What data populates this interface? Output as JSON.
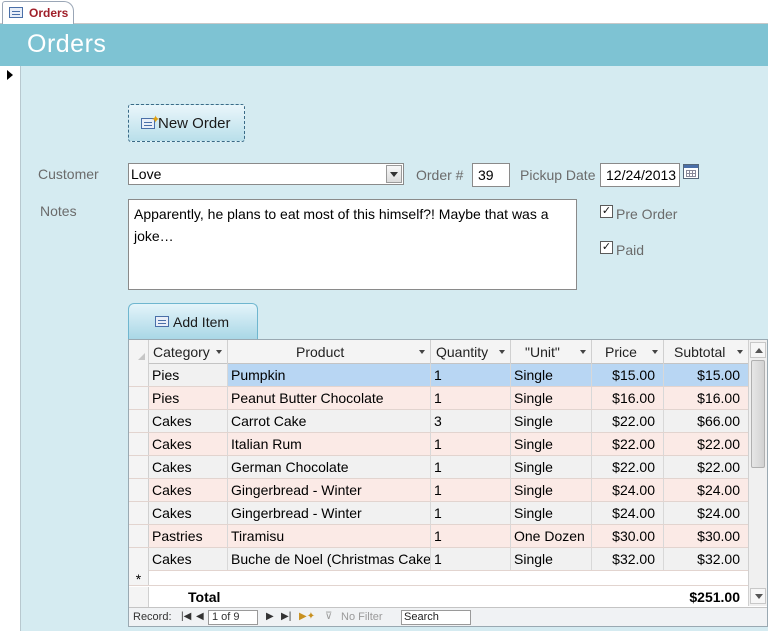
{
  "tab": {
    "label": "Orders",
    "icon": "form-icon"
  },
  "header": {
    "title": "Orders"
  },
  "form": {
    "new_order_label": "New Order",
    "customer_label": "Customer",
    "customer_value": "Love",
    "order_no_label": "Order #",
    "order_no_value": "39",
    "pickup_label": "Pickup Date",
    "pickup_value": "12/24/2013",
    "notes_label": "Notes",
    "notes_value": "Apparently, he plans to eat most of this himself?! Maybe that was a joke…",
    "pre_order_label": "Pre Order",
    "pre_order_checked": true,
    "paid_label": "Paid",
    "paid_checked": true,
    "add_item_label": "Add Item"
  },
  "grid": {
    "columns": [
      "Category",
      "Product",
      "Quantity",
      "\"Unit\"",
      "Price",
      "Subtotal"
    ],
    "rows": [
      {
        "category": "Pies",
        "product": "Pumpkin",
        "quantity": "1",
        "unit": "Single",
        "price": "$15.00",
        "subtotal": "$15.00",
        "selected": true
      },
      {
        "category": "Pies",
        "product": "Peanut Butter Chocolate",
        "quantity": "1",
        "unit": "Single",
        "price": "$16.00",
        "subtotal": "$16.00"
      },
      {
        "category": "Cakes",
        "product": "Carrot Cake",
        "quantity": "3",
        "unit": "Single",
        "price": "$22.00",
        "subtotal": "$66.00"
      },
      {
        "category": "Cakes",
        "product": "Italian Rum",
        "quantity": "1",
        "unit": "Single",
        "price": "$22.00",
        "subtotal": "$22.00"
      },
      {
        "category": "Cakes",
        "product": "German Chocolate",
        "quantity": "1",
        "unit": "Single",
        "price": "$22.00",
        "subtotal": "$22.00"
      },
      {
        "category": "Cakes",
        "product": "Gingerbread - Winter",
        "quantity": "1",
        "unit": "Single",
        "price": "$24.00",
        "subtotal": "$24.00"
      },
      {
        "category": "Cakes",
        "product": "Gingerbread - Winter",
        "quantity": "1",
        "unit": "Single",
        "price": "$24.00",
        "subtotal": "$24.00"
      },
      {
        "category": "Pastries",
        "product": "Tiramisu",
        "quantity": "1",
        "unit": "One Dozen",
        "price": "$30.00",
        "subtotal": "$30.00"
      },
      {
        "category": "Cakes",
        "product": "Buche de Noel (Christmas Cake)",
        "quantity": "1",
        "unit": "Single",
        "price": "$32.00",
        "subtotal": "$32.00"
      }
    ],
    "new_row_marker": "*",
    "total_label": "Total",
    "total_value": "$251.00"
  },
  "navigation": {
    "record_label": "Record:",
    "current": "1 of 9",
    "no_filter_label": "No Filter",
    "search_placeholder": "Search"
  },
  "colors": {
    "header_band": "#7ec3d3",
    "form_background": "#d5ebf1",
    "selected_row": "#b8d6f3",
    "alt_row": "#fbeae6",
    "tab_text": "#a0202a"
  }
}
